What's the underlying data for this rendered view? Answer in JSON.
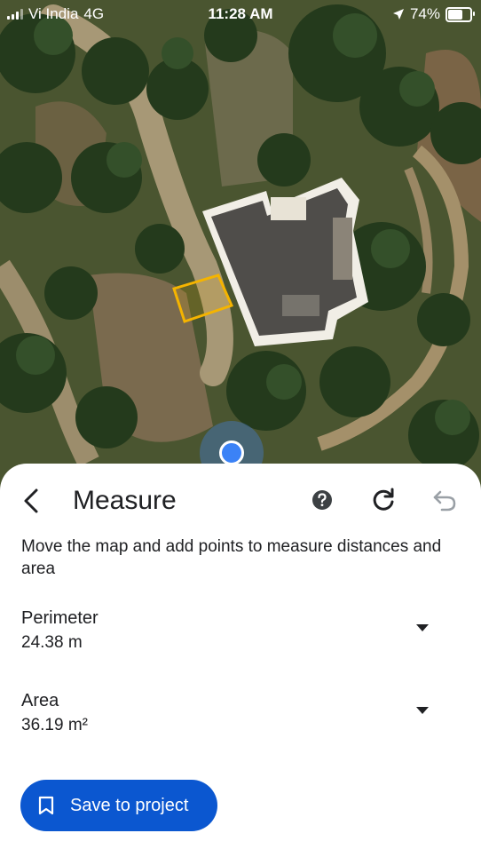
{
  "status_bar": {
    "carrier": "Vi India",
    "network": "4G",
    "time": "11:28 AM",
    "battery": "74%",
    "battery_level": 0.74,
    "icons": [
      "signal-icon",
      "location-arrow-icon",
      "battery-icon"
    ]
  },
  "map": {
    "type": "satellite",
    "icons": [
      "current-location-icon"
    ],
    "measure_polygon_color": "#f5b400"
  },
  "sheet": {
    "title": "Measure",
    "instructions": "Move the map and add points to measure distances and area",
    "icons": [
      "back-arrow-icon",
      "help-icon",
      "refresh-icon",
      "undo-icon"
    ],
    "perimeter": {
      "label": "Perimeter",
      "value": "24.38 m"
    },
    "area": {
      "label": "Area",
      "value": "36.19 m²"
    },
    "save_button": {
      "label": "Save to project",
      "icon": "bookmark-icon"
    }
  },
  "colors": {
    "accent": "#0b57d0",
    "location_blue": "#3b82f6",
    "polygon": "#f5b400"
  }
}
